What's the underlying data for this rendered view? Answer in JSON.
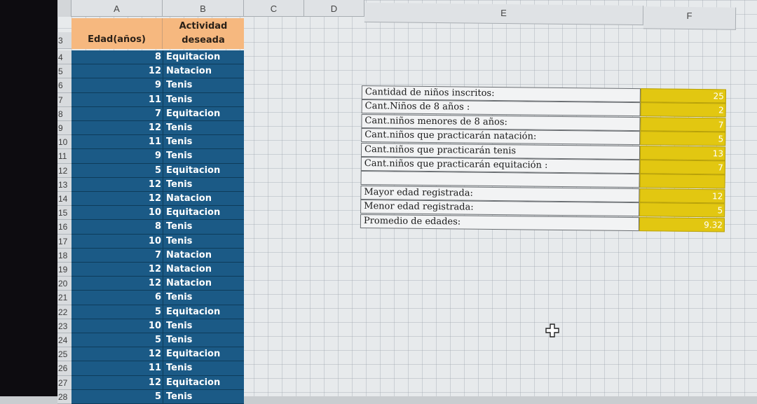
{
  "columns": [
    "A",
    "B",
    "C",
    "D",
    "E",
    "F"
  ],
  "header": {
    "row_number": "3",
    "col_a": "Edad(años)",
    "col_b_line1": "Actividad",
    "col_b_line2": "deseada"
  },
  "rows": [
    {
      "n": "4",
      "age": "8",
      "activity": "Equitacion"
    },
    {
      "n": "5",
      "age": "12",
      "activity": "Natacion"
    },
    {
      "n": "6",
      "age": "9",
      "activity": "Tenis"
    },
    {
      "n": "7",
      "age": "11",
      "activity": "Tenis"
    },
    {
      "n": "8",
      "age": "7",
      "activity": "Equitacion"
    },
    {
      "n": "9",
      "age": "12",
      "activity": "Tenis"
    },
    {
      "n": "10",
      "age": "11",
      "activity": "Tenis"
    },
    {
      "n": "11",
      "age": "9",
      "activity": "Tenis"
    },
    {
      "n": "12",
      "age": "5",
      "activity": "Equitacion"
    },
    {
      "n": "13",
      "age": "12",
      "activity": "Tenis"
    },
    {
      "n": "14",
      "age": "12",
      "activity": "Natacion"
    },
    {
      "n": "15",
      "age": "10",
      "activity": "Equitacion"
    },
    {
      "n": "16",
      "age": "8",
      "activity": "Tenis"
    },
    {
      "n": "17",
      "age": "10",
      "activity": "Tenis"
    },
    {
      "n": "18",
      "age": "7",
      "activity": "Natacion"
    },
    {
      "n": "19",
      "age": "12",
      "activity": "Natacion"
    },
    {
      "n": "20",
      "age": "12",
      "activity": "Natacion"
    },
    {
      "n": "21",
      "age": "6",
      "activity": "Tenis"
    },
    {
      "n": "22",
      "age": "5",
      "activity": "Equitacion"
    },
    {
      "n": "23",
      "age": "10",
      "activity": "Tenis"
    },
    {
      "n": "24",
      "age": "5",
      "activity": "Tenis"
    },
    {
      "n": "25",
      "age": "12",
      "activity": "Equitacion"
    },
    {
      "n": "26",
      "age": "11",
      "activity": "Tenis"
    },
    {
      "n": "27",
      "age": "12",
      "activity": "Equitacion"
    },
    {
      "n": "28",
      "age": "5",
      "activity": "Tenis"
    }
  ],
  "summary": [
    {
      "label": "Cantidad de niños inscritos:",
      "value": "25"
    },
    {
      "label": "Cant.Niños de 8 años :",
      "value": "2"
    },
    {
      "label": "Cant.niños menores de 8 años:",
      "value": "7"
    },
    {
      "label": "Cant.niños que practicarán natación:",
      "value": "5"
    },
    {
      "label": "Cant.niños que practicarán tenis",
      "value": "13"
    },
    {
      "label": "Cant.niños que practicarán equitación :",
      "value": "7"
    },
    {
      "label": "",
      "value": ""
    },
    {
      "label": "Mayor edad registrada:",
      "value": "12"
    },
    {
      "label": "Menor edad registrada:",
      "value": "5"
    },
    {
      "label": "Promedio de edades:",
      "value": "9.32"
    }
  ],
  "colors": {
    "header_fill": "#f6b87f",
    "data_fill": "#1b5a86",
    "result_fill": "#e2c711"
  }
}
